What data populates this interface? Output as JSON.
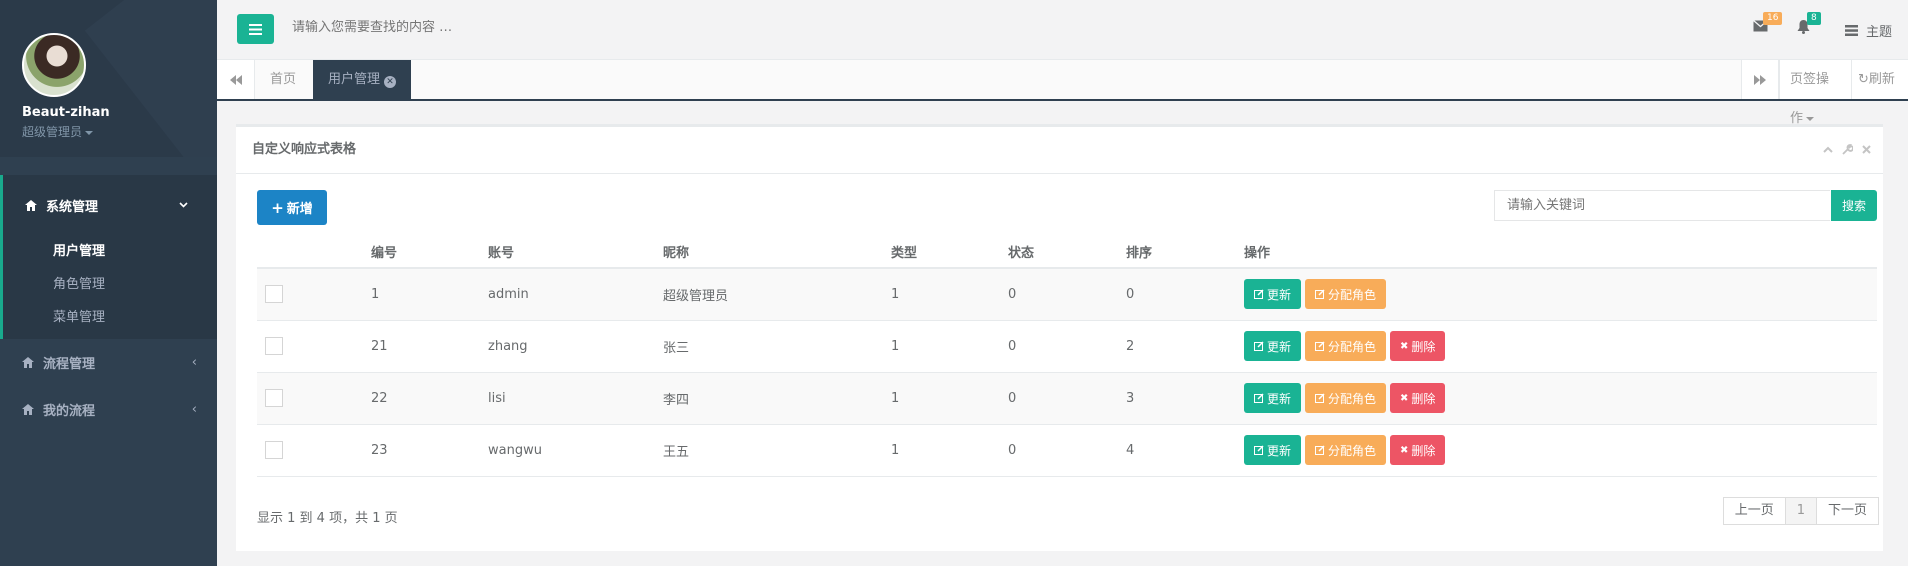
{
  "user": {
    "name": "Beaut-zihan",
    "role": "超级管理员"
  },
  "menu": {
    "group": {
      "label": "系统管理",
      "items": [
        "用户管理",
        "角色管理",
        "菜单管理"
      ],
      "active": 0
    },
    "others": [
      "流程管理",
      "我的流程"
    ]
  },
  "top": {
    "search_placeholder": "请输入您需要查找的内容 …",
    "mail_count": "16",
    "bell_count": "8",
    "theme_label": "主题"
  },
  "tabs": {
    "home": "首页",
    "current": "用户管理",
    "ops": "页签操作",
    "refresh": "刷新"
  },
  "panel": {
    "title": "自定义响应式表格",
    "add_label": "新增",
    "keyword_placeholder": "请输入关键词",
    "search_label": "搜索"
  },
  "table": {
    "headers": [
      "",
      "编号",
      "账号",
      "昵称",
      "类型",
      "状态",
      "排序",
      "操作"
    ],
    "rows": [
      {
        "id": "1",
        "account": "admin",
        "nickname": "超级管理员",
        "type": "1",
        "status": "0",
        "sort": "0",
        "can_delete": false
      },
      {
        "id": "21",
        "account": "zhang",
        "nickname": "张三",
        "type": "1",
        "status": "0",
        "sort": "2",
        "can_delete": true
      },
      {
        "id": "22",
        "account": "lisi",
        "nickname": "李四",
        "type": "1",
        "status": "0",
        "sort": "3",
        "can_delete": true
      },
      {
        "id": "23",
        "account": "wangwu",
        "nickname": "王五",
        "type": "1",
        "status": "0",
        "sort": "4",
        "can_delete": true
      }
    ],
    "actions": {
      "update": "更新",
      "assign": "分配角色",
      "delete": "删除"
    }
  },
  "pagination": {
    "info": "显示 1 到 4 项，共 1 页",
    "prev": "上一页",
    "page": "1",
    "next": "下一页"
  },
  "colors": {
    "sidebar": "#2f4050",
    "teal": "#1ab394",
    "blue": "#1c84c6",
    "orange": "#f8ac59",
    "red": "#ed5565"
  }
}
